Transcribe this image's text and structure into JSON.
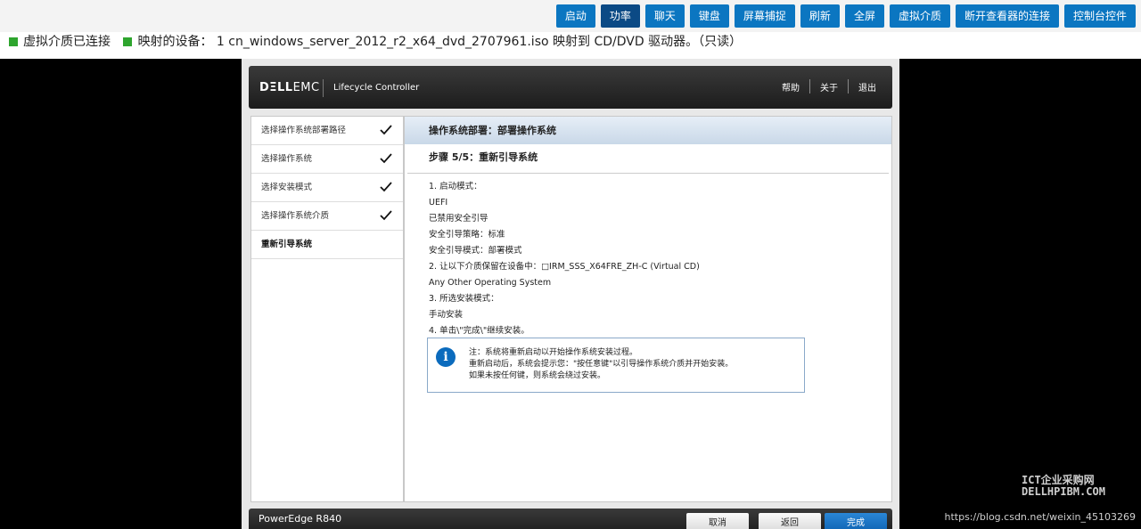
{
  "toolbar": {
    "buttons": [
      "启动",
      "功率",
      "聊天",
      "键盘",
      "屏幕捕捉",
      "刷新",
      "全屏",
      "虚拟介质",
      "断开查看器的连接",
      "控制台控件"
    ],
    "active_index": 1
  },
  "status": {
    "media_connected": "虚拟介质已连接",
    "mapped_device": "映射的设备：  1   cn_windows_server_2012_r2_x64_dvd_2707961.iso 映射到 CD/DVD 驱动器。（只读）"
  },
  "header": {
    "logo_dell": "DΞLL",
    "logo_emc": "EMC",
    "title": "Lifecycle Controller",
    "links": [
      "帮助",
      "关于",
      "退出"
    ]
  },
  "sidebar": {
    "items": [
      {
        "label": "选择操作系统部署路径",
        "done": true
      },
      {
        "label": "选择操作系统",
        "done": true
      },
      {
        "label": "选择安装模式",
        "done": true
      },
      {
        "label": "选择操作系统介质",
        "done": true
      },
      {
        "label": "重新引导系统",
        "done": false
      }
    ]
  },
  "main": {
    "title": "操作系统部署：部署操作系统",
    "step": "步骤 5/5：重新引导系统",
    "lines": [
      "1. 启动模式：",
      "UEFI",
      "已禁用安全引导",
      "安全引导策略：标准",
      "安全引导模式：部署模式",
      "2. 让以下介质保留在设备中：□IRM_SSS_X64FRE_ZH-C (Virtual CD)",
      "Any Other Operating System",
      "3. 所选安装模式：",
      "手动安装",
      "4. 单击\\\"完成\\\"继续安装。"
    ],
    "note": {
      "line1": "注：系统将重新启动以开始操作系统安装过程。",
      "line2": "重新启动后，系统会提示您：\"按任意键\"以引导操作系统介质并开始安装。",
      "line3": "如果未按任何键，则系统会绕过安装。"
    }
  },
  "footer": {
    "model": "PowerEdge R840",
    "cancel": "取消",
    "back": "返回",
    "finish": "完成"
  },
  "overlay": {
    "watermark_line1": "ICT企业采购网",
    "watermark_line2": "DELLHPIBM.COM",
    "url": "https://blog.csdn.net/weixin_45103269"
  },
  "colors": {
    "toolbar_button": "#0b76c1",
    "toolbar_button_active": "#0b4a85",
    "status_square": "#2ea52e",
    "primary_button": "#0b5fae"
  }
}
